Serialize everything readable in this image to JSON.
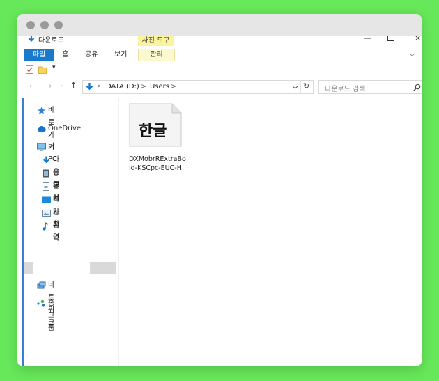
{
  "window": {
    "title": "다운로드"
  },
  "ribbon": {
    "tabs": [
      {
        "label": "파일"
      },
      {
        "label": "홈"
      },
      {
        "label": "공유"
      },
      {
        "label": "보기"
      }
    ],
    "context_label": "사진 도구",
    "context_tab": "관리"
  },
  "navigation": {
    "path_prefix": "«",
    "path": [
      "DATA (D:)",
      "Users"
    ],
    "separator": ">",
    "search_placeholder": "다운로드 검색"
  },
  "sidebar": {
    "quick_access": "바로 가기",
    "onedrive": "OneDrive",
    "this_pc": "내 PC",
    "pc_items": [
      {
        "label": "다운로드",
        "icon": "download-icon"
      },
      {
        "label": "동영상",
        "icon": "video-icon"
      },
      {
        "label": "문서",
        "icon": "document-icon"
      },
      {
        "label": "바탕 화면",
        "icon": "desktop-icon"
      },
      {
        "label": "사진",
        "icon": "picture-icon"
      },
      {
        "label": "음악",
        "icon": "music-icon"
      }
    ],
    "network": "네트워크",
    "homegroup": "홈 그룹"
  },
  "files": [
    {
      "icon_text": "한글",
      "name_line1": "DXMobrRExtraBo",
      "name_line2": "ld-KSCpc-EUC-H"
    }
  ],
  "colors": {
    "background": "#67e85a",
    "accent": "#1979ca",
    "context_tab": "#fbf49c"
  }
}
